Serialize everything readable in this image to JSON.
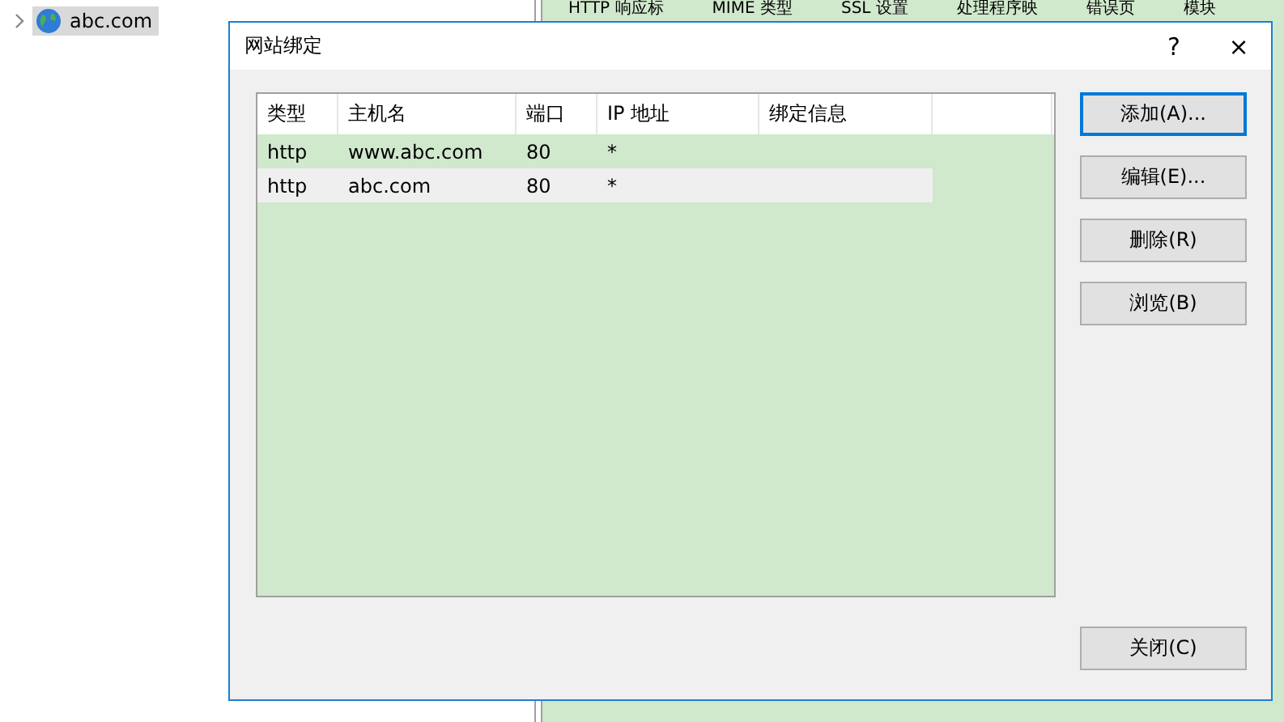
{
  "tree": {
    "items": [
      {
        "label": "abc.com",
        "selected": true
      }
    ]
  },
  "feature_tabs": [
    "HTTP 响应标",
    "MIME 类型",
    "SSL 设置",
    "处理程序映",
    "错误页",
    "模块"
  ],
  "dialog": {
    "title": "网站绑定",
    "help": "?",
    "close": "×",
    "table": {
      "columns": [
        "类型",
        "主机名",
        "端口",
        "IP 地址",
        "绑定信息"
      ],
      "rows": [
        {
          "cells": [
            "http",
            "www.abc.com",
            "80",
            "*",
            ""
          ],
          "selected": false
        },
        {
          "cells": [
            "http",
            "abc.com",
            "80",
            "*",
            ""
          ],
          "selected": true
        }
      ]
    },
    "buttons": [
      {
        "label": "添加(A)...",
        "focused": true
      },
      {
        "label": "编辑(E)...",
        "focused": false
      },
      {
        "label": "删除(R)",
        "focused": false
      },
      {
        "label": "浏览(B)",
        "focused": false
      }
    ],
    "close_button": {
      "label": "关闭(C)"
    }
  }
}
